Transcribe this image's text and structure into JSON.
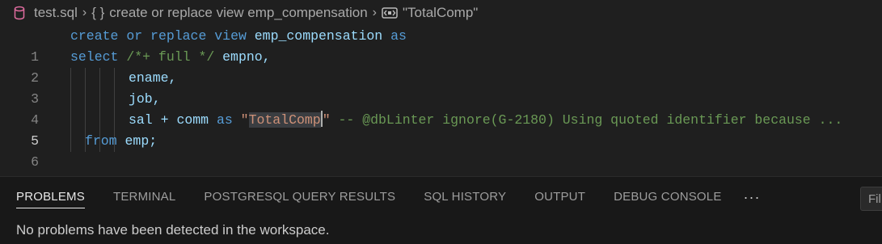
{
  "breadcrumb": {
    "file": "test.sql",
    "braces": "{ }",
    "view": "create or replace view emp_compensation",
    "column": "\"TotalComp\""
  },
  "editor": {
    "line_numbers": [
      "1",
      "2",
      "3",
      "4",
      "5",
      "6"
    ],
    "active_line": "5",
    "lines": {
      "l1": {
        "t1": "create",
        "t2": "or",
        "t3": "replace",
        "t4": "view",
        "t5": "emp_compensation",
        "t6": "as"
      },
      "l2": {
        "t1": "select",
        "t2": "/*+ full */",
        "t3": "empno,"
      },
      "l3": {
        "t1": "ename,"
      },
      "l4": {
        "t1": "job,"
      },
      "l5": {
        "t1": "sal",
        "t2": "+",
        "t3": "comm",
        "t4": "as",
        "t5": "\"",
        "t6": "TotalComp",
        "t7": "\"",
        "t8": "-- @dbLinter ignore(G-2180) Using quoted identifier because ..."
      },
      "l6": {
        "t1": "from",
        "t2": "emp;"
      }
    }
  },
  "panel": {
    "tabs": [
      "PROBLEMS",
      "TERMINAL",
      "POSTGRESQL QUERY RESULTS",
      "SQL HISTORY",
      "OUTPUT",
      "DEBUG CONSOLE"
    ],
    "more": "···",
    "filter_text": "Fil",
    "message": "No problems have been detected in the workspace."
  },
  "colors": {
    "keyword": "#569cd6",
    "identifier": "#9cdcfe",
    "comment": "#6a9955",
    "string": "#ce9178",
    "background": "#1f1f1f"
  },
  "icons": [
    "database-icon",
    "chevron-right-icon",
    "symbol-field-icon",
    "more-icon"
  ]
}
